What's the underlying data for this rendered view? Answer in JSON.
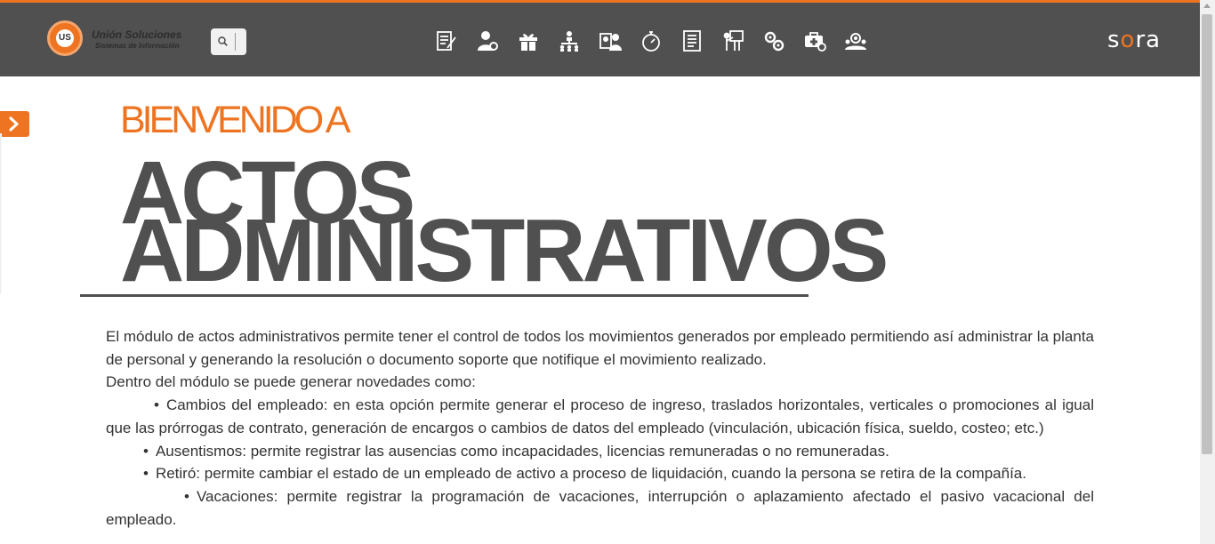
{
  "header": {
    "logo": {
      "mark_text": "US",
      "name": "Unión Soluciones",
      "tagline": "Sistemas de Información"
    },
    "search": {
      "placeholder": ""
    },
    "module_icons": [
      "document-edit-icon",
      "user-settings-icon",
      "gift-icon",
      "org-chart-icon",
      "employee-card-icon",
      "stopwatch-icon",
      "document-list-icon",
      "presentation-icon",
      "gears-icon",
      "medical-kit-icon",
      "people-search-icon"
    ],
    "brand": {
      "prefix": "s",
      "accent": "o",
      "suffix": "ra"
    }
  },
  "hero": {
    "welcome": "BIENVENIDO A",
    "title_line1": "ACTOS",
    "title_line2": "ADMINISTRATIVOS"
  },
  "content": {
    "intro": "El módulo de actos administrativos permite tener el control de todos los movimientos generados por empleado permitiendo así administrar la planta de personal y generando la resolución o documento soporte que notifique el movimiento realizado.",
    "subheading": "Dentro del módulo se puede generar novedades como:",
    "bullet": "•",
    "items": [
      "Cambios del empleado: en esta opción permite generar el proceso de ingreso, traslados horizontales, verticales o promociones al igual que las prórrogas de contrato, generación de encargos o cambios de datos del empleado (vinculación, ubicación física, sueldo, costeo; etc.)",
      "Ausentismos: permite registrar las ausencias como incapacidades, licencias remuneradas o no remuneradas.",
      "Retiró: permite cambiar el estado de un empleado de activo a proceso de liquidación, cuando la persona se retira de la compañía.",
      "Vacaciones: permite registrar la programación de vacaciones, interrupción o aplazamiento afectado el pasivo vacacional del empleado."
    ]
  },
  "colors": {
    "accent": "#ee7421",
    "header_bg": "#505050",
    "title": "#505050",
    "text": "#333333"
  }
}
